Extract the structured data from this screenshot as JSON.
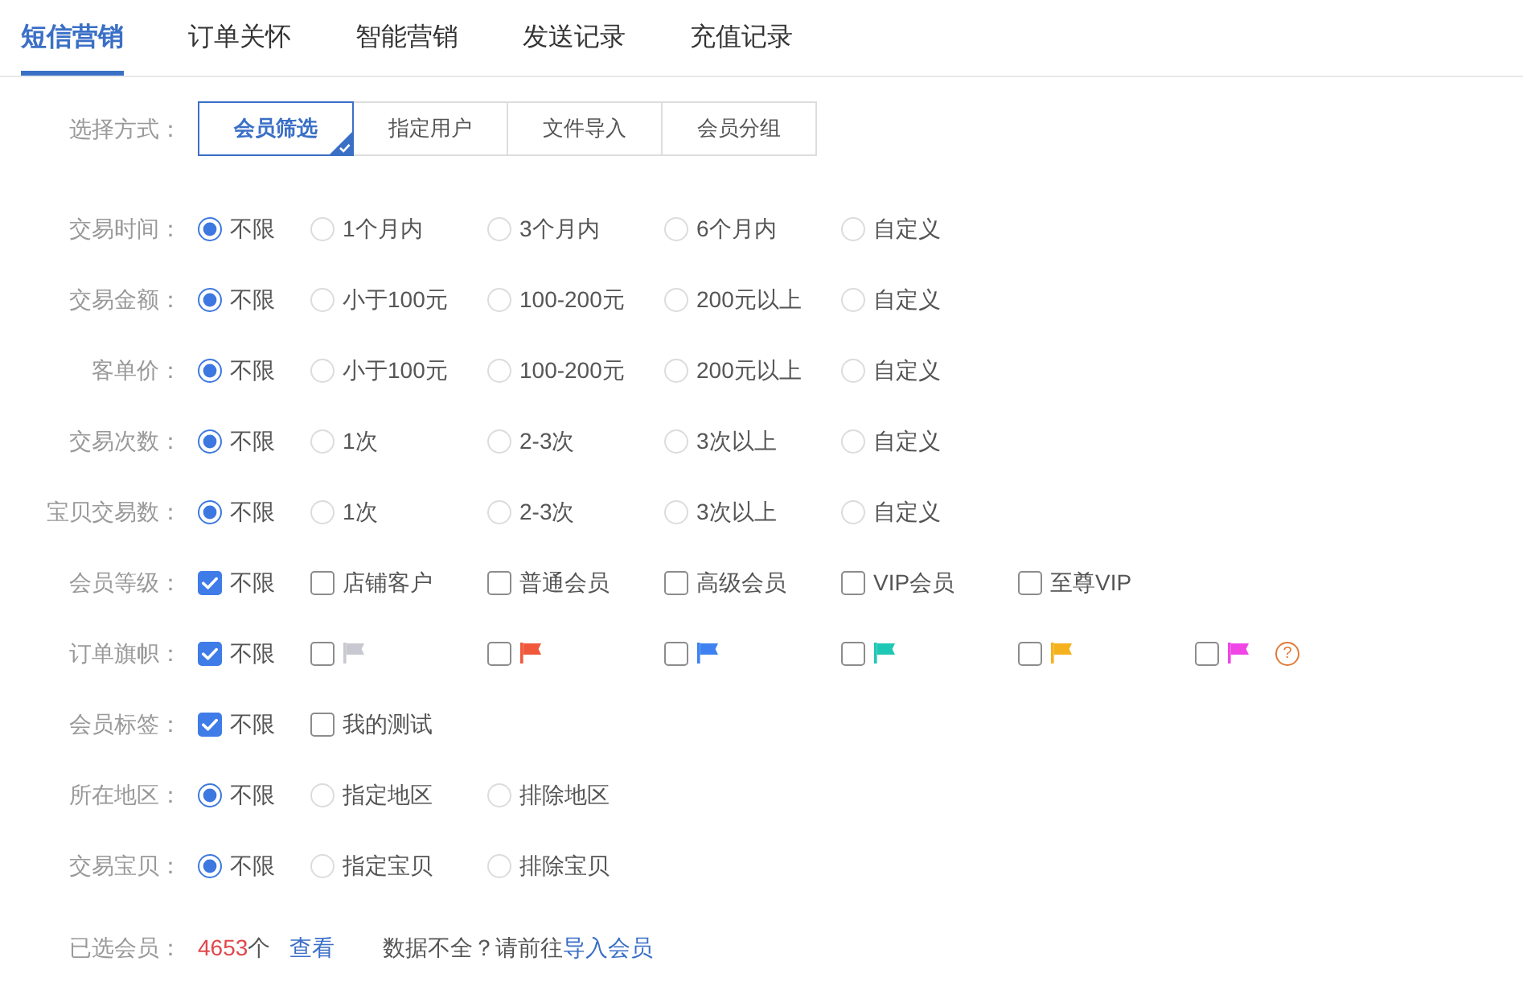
{
  "tabs": [
    {
      "label": "短信营销",
      "selected": true
    },
    {
      "label": "订单关怀",
      "selected": false
    },
    {
      "label": "智能营销",
      "selected": false
    },
    {
      "label": "发送记录",
      "selected": false
    },
    {
      "label": "充值记录",
      "selected": false
    }
  ],
  "selection_mode": {
    "label": "选择方式：",
    "options": [
      {
        "label": "会员筛选",
        "selected": true
      },
      {
        "label": "指定用户",
        "selected": false
      },
      {
        "label": "文件导入",
        "selected": false
      },
      {
        "label": "会员分组",
        "selected": false
      }
    ]
  },
  "filters": [
    {
      "label": "交易时间：",
      "kind": "radio",
      "options": [
        {
          "label": "不限",
          "selected": true
        },
        {
          "label": "1个月内",
          "selected": false
        },
        {
          "label": "3个月内",
          "selected": false
        },
        {
          "label": "6个月内",
          "selected": false
        },
        {
          "label": "自定义",
          "selected": false
        }
      ]
    },
    {
      "label": "交易金额：",
      "kind": "radio",
      "options": [
        {
          "label": "不限",
          "selected": true
        },
        {
          "label": "小于100元",
          "selected": false
        },
        {
          "label": "100-200元",
          "selected": false
        },
        {
          "label": "200元以上",
          "selected": false
        },
        {
          "label": "自定义",
          "selected": false
        }
      ]
    },
    {
      "label": "客单价：",
      "kind": "radio",
      "options": [
        {
          "label": "不限",
          "selected": true
        },
        {
          "label": "小于100元",
          "selected": false
        },
        {
          "label": "100-200元",
          "selected": false
        },
        {
          "label": "200元以上",
          "selected": false
        },
        {
          "label": "自定义",
          "selected": false
        }
      ]
    },
    {
      "label": "交易次数：",
      "kind": "radio",
      "options": [
        {
          "label": "不限",
          "selected": true
        },
        {
          "label": "1次",
          "selected": false
        },
        {
          "label": "2-3次",
          "selected": false
        },
        {
          "label": "3次以上",
          "selected": false
        },
        {
          "label": "自定义",
          "selected": false
        }
      ]
    },
    {
      "label": "宝贝交易数：",
      "kind": "radio",
      "options": [
        {
          "label": "不限",
          "selected": true
        },
        {
          "label": "1次",
          "selected": false
        },
        {
          "label": "2-3次",
          "selected": false
        },
        {
          "label": "3次以上",
          "selected": false
        },
        {
          "label": "自定义",
          "selected": false
        }
      ]
    },
    {
      "label": "会员等级：",
      "kind": "checkbox",
      "options": [
        {
          "label": "不限",
          "checked": true
        },
        {
          "label": "店铺客户",
          "checked": false
        },
        {
          "label": "普通会员",
          "checked": false
        },
        {
          "label": "高级会员",
          "checked": false
        },
        {
          "label": "VIP会员",
          "checked": false
        },
        {
          "label": "至尊VIP",
          "checked": false
        }
      ]
    },
    {
      "label": "订单旗帜：",
      "kind": "checkbox",
      "help": "?",
      "options": [
        {
          "kind": "text",
          "label": "不限",
          "checked": true
        },
        {
          "kind": "flag",
          "color": "#c8c8d0",
          "checked": false
        },
        {
          "kind": "flag",
          "color": "#f0583c",
          "checked": false
        },
        {
          "kind": "flag",
          "color": "#3d82f0",
          "checked": false
        },
        {
          "kind": "flag",
          "color": "#1ec8b4",
          "checked": false
        },
        {
          "kind": "flag",
          "color": "#f5b21e",
          "checked": false
        },
        {
          "kind": "flag",
          "color": "#f046e6",
          "checked": false
        }
      ]
    },
    {
      "label": "会员标签：",
      "kind": "checkbox",
      "options": [
        {
          "label": "不限",
          "checked": true
        },
        {
          "label": "我的测试",
          "checked": false
        }
      ]
    },
    {
      "label": "所在地区：",
      "kind": "radio",
      "options": [
        {
          "label": "不限",
          "selected": true
        },
        {
          "label": "指定地区",
          "selected": false
        },
        {
          "label": "排除地区",
          "selected": false
        }
      ]
    },
    {
      "label": "交易宝贝：",
      "kind": "radio",
      "options": [
        {
          "label": "不限",
          "selected": true
        },
        {
          "label": "指定宝贝",
          "selected": false
        },
        {
          "label": "排除宝贝",
          "selected": false
        }
      ]
    }
  ],
  "selected_members": {
    "label": "已选会员：",
    "count": "4653",
    "unit": "个",
    "view_link": "查看",
    "hint": "数据不全？请前往",
    "hint_link": "导入会员"
  }
}
